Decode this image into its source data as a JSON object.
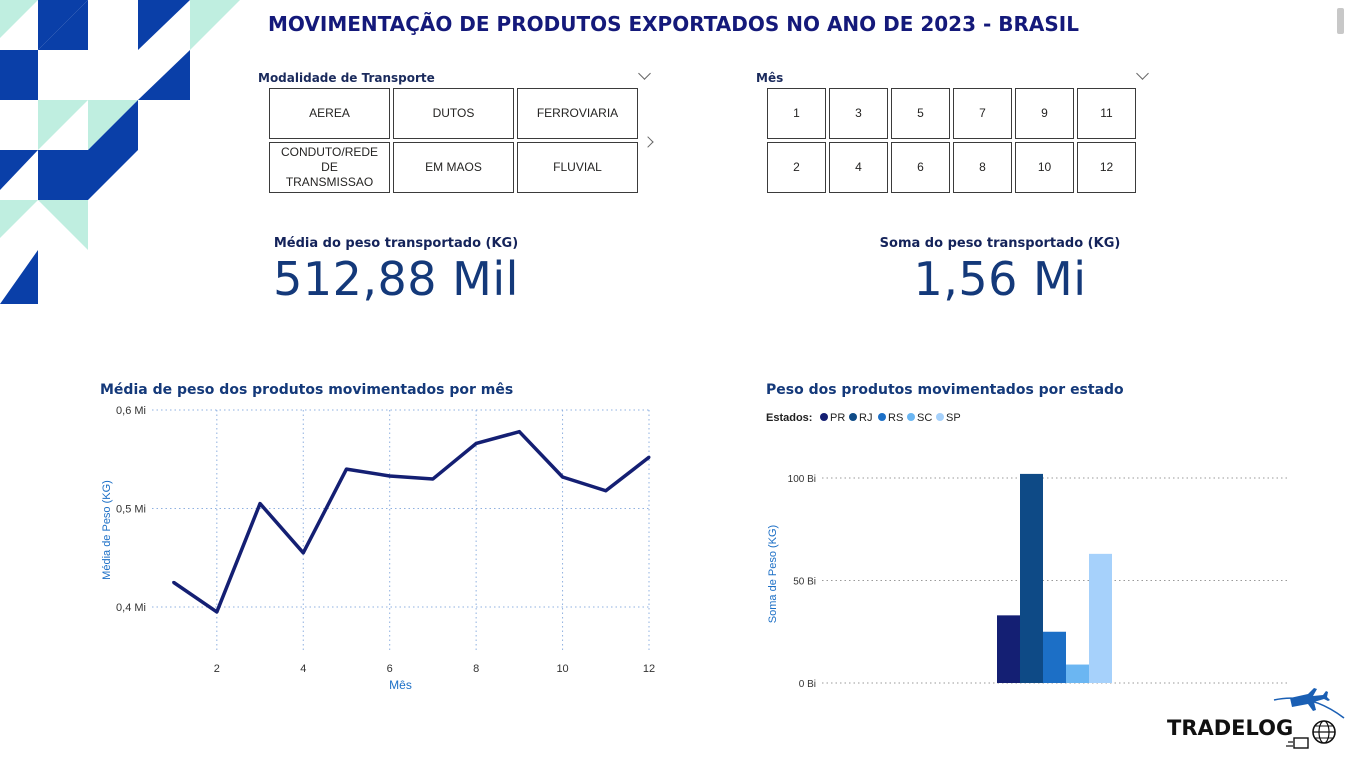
{
  "page": {
    "title": "MOVIMENTAÇÃO DE PRODUTOS EXPORTADOS NO ANO DE 2023 - BRASIL"
  },
  "colors": {
    "title": "#14197a",
    "deco_blue": "#0a3fa8",
    "deco_mint": "#bfeee0",
    "line": "#141f73",
    "bars": [
      "#141f73",
      "#0e4a86",
      "#1c6fc6",
      "#6bb6f2",
      "#a6d1fb"
    ]
  },
  "transport_slicer": {
    "header": "Modalidade de Transporte",
    "options": [
      "AEREA",
      "DUTOS",
      "FERROVIARIA",
      "CONDUTO/REDE DE TRANSMISSAO",
      "EM MAOS",
      "FLUVIAL"
    ]
  },
  "month_slicer": {
    "header": "Mês",
    "options": [
      "1",
      "3",
      "5",
      "7",
      "9",
      "11",
      "2",
      "4",
      "6",
      "8",
      "10",
      "12"
    ]
  },
  "kpi_avg": {
    "label": "Média do peso transportado (KG)",
    "value": "512,88 Mil"
  },
  "kpi_sum": {
    "label": "Soma do peso transportado (KG)",
    "value": "1,56 Mi"
  },
  "chart_data": [
    {
      "type": "line",
      "title": "Média de peso dos produtos movimentados por mês",
      "xlabel": "Mês",
      "ylabel": "Média de Peso (KG)",
      "x": [
        1,
        2,
        3,
        4,
        5,
        6,
        7,
        8,
        9,
        10,
        11,
        12
      ],
      "values": [
        0.425,
        0.395,
        0.505,
        0.455,
        0.54,
        0.533,
        0.53,
        0.566,
        0.578,
        0.532,
        0.518,
        0.552
      ],
      "xticks": [
        "2",
        "4",
        "6",
        "8",
        "10",
        "12"
      ],
      "yticks": [
        "0,4 Mi",
        "0,5 Mi",
        "0,6 Mi"
      ],
      "ylim": [
        0.4,
        0.6
      ],
      "grid": true
    },
    {
      "type": "bar",
      "title": "Peso dos produtos movimentados por estado",
      "legend_title": "Estados:",
      "legend_position": "top-left",
      "ylabel": "Soma de Peso (KG)",
      "series": [
        {
          "name": "PR",
          "values": [
            33
          ]
        },
        {
          "name": "RJ",
          "values": [
            102
          ]
        },
        {
          "name": "RS",
          "values": [
            25
          ]
        },
        {
          "name": "SC",
          "values": [
            9
          ]
        },
        {
          "name": "SP",
          "values": [
            63
          ]
        }
      ],
      "yticks": [
        "0 Bi",
        "50 Bi",
        "100 Bi"
      ],
      "ylim": [
        0,
        100
      ],
      "grid": true
    }
  ],
  "brand": {
    "name": "TRADELOG"
  }
}
